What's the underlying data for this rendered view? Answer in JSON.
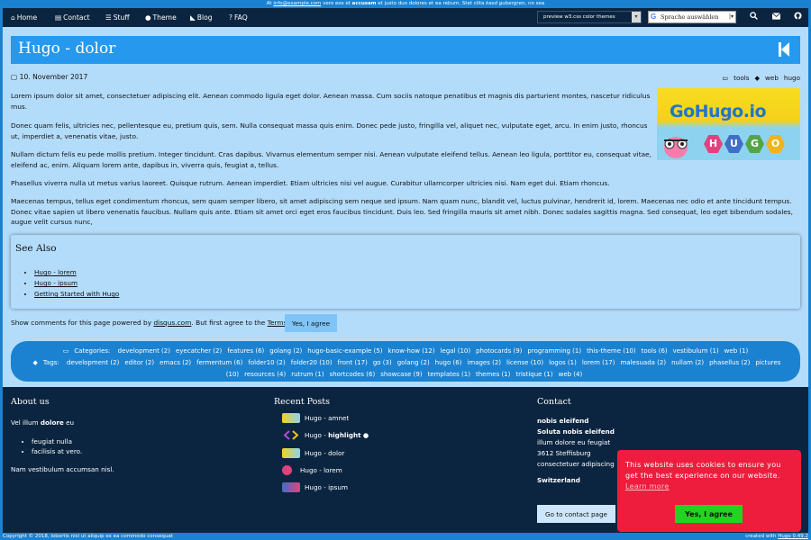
{
  "topbar": {
    "pre": "At",
    "email": "info@example.com",
    "mid": "vero eos et",
    "accusam": "accusam",
    "mid2": "et justo duo dolores et ea rebum. Stet clita",
    "kasd": "kasd gubergren",
    "end": ", no sea"
  },
  "nav": {
    "items": [
      {
        "icon": "home-icon",
        "glyph": "⌂",
        "label": "Home"
      },
      {
        "icon": "contact-card-icon",
        "glyph": "▤",
        "label": "Contact"
      },
      {
        "icon": "list-icon",
        "glyph": "☰",
        "label": "Stuff"
      },
      {
        "icon": "info-icon",
        "glyph": "●",
        "label": "Theme"
      },
      {
        "icon": "rss-icon",
        "glyph": "◣",
        "label": "Blog"
      },
      {
        "icon": "question-icon",
        "glyph": "?",
        "label": "FAQ"
      }
    ],
    "preview_select": "preview w3.css color themes",
    "translate": "Sprache auswählen",
    "icons": [
      "search-icon",
      "envelope-icon",
      "github-icon"
    ]
  },
  "post": {
    "title": "Hugo - dolor",
    "date": "10. November 2017",
    "tags": [
      "tools",
      "web",
      "hugo"
    ],
    "hero_text": "GoHugo.io",
    "hero_letters": [
      "H",
      "U",
      "G",
      "O"
    ],
    "paragraphs": [
      "Lorem ipsum dolor sit amet, consectetuer adipiscing elit. Aenean commodo ligula eget dolor. Aenean massa. Cum sociis natoque penatibus et magnis dis parturient montes, nascetur ridiculus mus.",
      "Donec quam felis, ultricies nec, pellentesque eu, pretium quis, sem. Nulla consequat massa quis enim. Donec pede justo, fringilla vel, aliquet nec, vulputate eget, arcu. In enim justo, rhoncus ut, imperdiet a, venenatis vitae, justo.",
      "Nullam dictum felis eu pede mollis pretium. Integer tincidunt. Cras dapibus. Vivamus elementum semper nisi. Aenean vulputate eleifend tellus. Aenean leo ligula, porttitor eu, consequat vitae, eleifend ac, enim. Aliquam lorem ante, dapibus in, viverra quis, feugiat a, tellus.",
      "Phasellus viverra nulla ut metus varius laoreet. Quisque rutrum. Aenean imperdiet. Etiam ultricies nisi vel augue. Curabitur ullamcorper ultricies nisi. Nam eget dui. Etiam rhoncus.",
      "Maecenas tempus, tellus eget condimentum rhoncus, sem quam semper libero, sit amet adipiscing sem neque sed ipsum. Nam quam nunc, blandit vel, luctus pulvinar, hendrerit id, lorem. Maecenas nec odio et ante tincidunt tempus. Donec vitae sapien ut libero venenatis faucibus. Nullam quis ante. Etiam sit amet orci eget eros faucibus tincidunt. Duis leo. Sed fringilla mauris sit amet nibh. Donec sodales sagittis magna. Sed consequat, leo eget bibendum sodales, augue velit cursus nunc,"
    ]
  },
  "see_also": {
    "heading": "See Also",
    "links": [
      "Hugo - lorem",
      "Hugo - ipsum",
      "Getting Started with Hugo"
    ]
  },
  "comments": {
    "pre": "Show comments for this page powered by",
    "disqus": "disqus.com",
    "mid": ". But first agree to the",
    "terms": "Terms",
    "button": "Yes, I agree"
  },
  "taxonomy": {
    "categories_label": "Categories:",
    "categories": [
      "development (2)",
      "eyecatcher (2)",
      "features (6)",
      "golang (2)",
      "hugo-basic-example (5)",
      "know-how (12)",
      "legal (10)",
      "photocards (9)",
      "programming (1)",
      "this-theme (10)",
      "tools (6)",
      "vestibulum (1)",
      "web (1)"
    ],
    "tags_label": "Tags:",
    "tags": [
      "development (2)",
      "editor (2)",
      "emacs (2)",
      "fermentum (6)",
      "folder10 (2)",
      "folder20 (10)",
      "front (17)",
      "go (3)",
      "golang (2)",
      "hugo (6)",
      "images (2)",
      "license (10)",
      "logos (1)",
      "lorem (17)",
      "malesuada (2)",
      "nullam (2)",
      "phasellus (2)",
      "pictures (10)",
      "resources (4)",
      "rutrum (1)",
      "shortcodes (6)",
      "showcase (9)",
      "templates (1)",
      "themes (1)",
      "tristique (1)",
      "web (4)"
    ]
  },
  "footer": {
    "about": {
      "heading": "About us",
      "intro_pre": "Vel illum",
      "intro_bold": "dolore",
      "intro_post": "eu",
      "bullets": [
        "feugiat nulla",
        "facilisis at vero."
      ],
      "outro": "Nam vestibulum accumsan nisl."
    },
    "recent": {
      "heading": "Recent Posts",
      "posts": [
        {
          "label": "Hugo - amnet",
          "thumb": "hugo-logo-thumb"
        },
        {
          "label_pre": "Hugo - ",
          "label_bold": "highlight",
          "thumb": "code-icon"
        },
        {
          "label": "Hugo - dolor",
          "thumb": "hugo-logo-thumb"
        },
        {
          "label": "Hugo - lorem",
          "thumb": "hugo-pink-thumb"
        },
        {
          "label": "Hugo - ipsum",
          "thumb": "hugo-blue-thumb"
        }
      ]
    },
    "contact": {
      "heading": "Contact",
      "line1": "nobis eleifend",
      "line2": "Soluta nobis eleifend",
      "line3": "illum dolore eu feugiat",
      "line4": "3612 Steffisburg",
      "line5": "consectetuer adipiscing",
      "line6": "Switzerland",
      "button": "Go to contact page"
    }
  },
  "cookie": {
    "text": "This website uses cookies to ensure you get the best experience on our website.",
    "learn_more": "Learn more",
    "button": "Yes, I agree"
  },
  "bottom": {
    "copyright": "Copyright © 2018, lobortis nisl ut aliquip ex ea commodo consequat",
    "created_pre": "created with",
    "created_link": "Hugo 0.49.2"
  },
  "colors": {
    "primary": "#1b82d1",
    "navbar": "#0b2540",
    "content_bg": "#b3dcfb",
    "title_bar": "#2699ee",
    "cookie": "#ee1d3d",
    "cookie_button": "#22d322"
  }
}
